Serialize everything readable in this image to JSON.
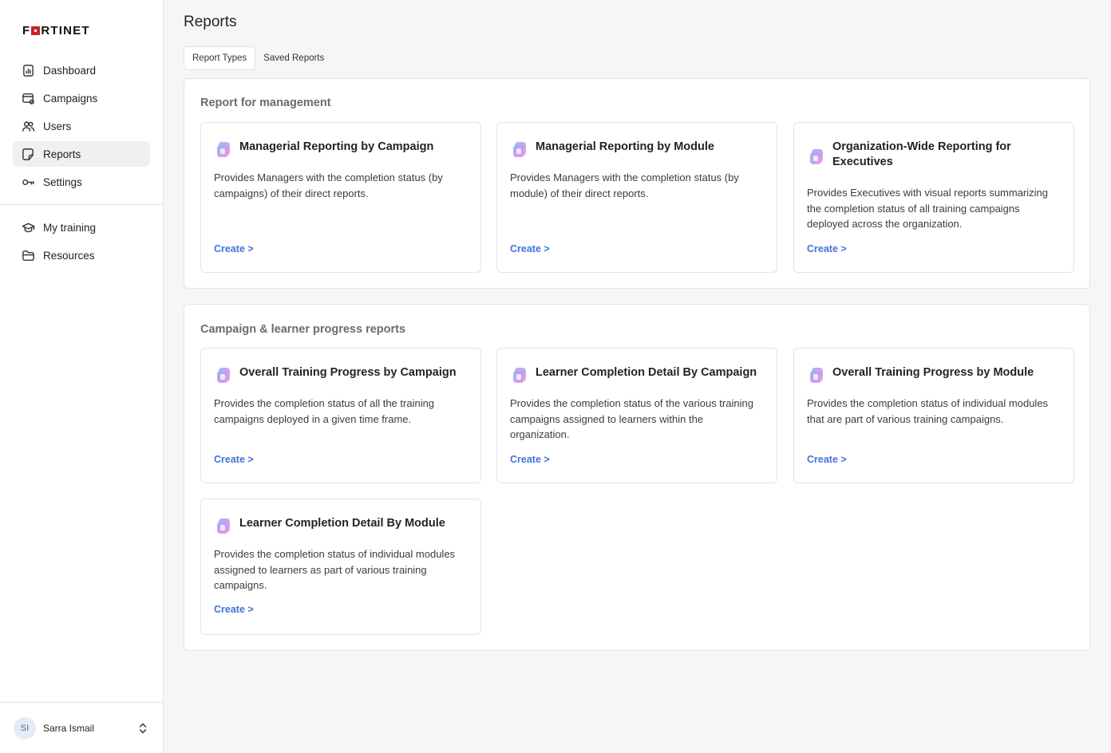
{
  "brand": {
    "logo_text_1": "F",
    "logo_text_2": "RTINET"
  },
  "sidebar": {
    "items": [
      {
        "label": "Dashboard"
      },
      {
        "label": "Campaigns"
      },
      {
        "label": "Users"
      },
      {
        "label": "Reports"
      },
      {
        "label": "Settings"
      }
    ],
    "secondary_items": [
      {
        "label": "My training"
      },
      {
        "label": "Resources"
      }
    ],
    "user": {
      "initials": "SI",
      "name": "Sarra Ismail"
    }
  },
  "page": {
    "title": "Reports",
    "tabs": [
      {
        "label": "Report Types"
      },
      {
        "label": "Saved Reports"
      }
    ]
  },
  "sections": [
    {
      "title": "Report for management",
      "cards": [
        {
          "title": "Managerial Reporting by Campaign",
          "description": "Provides Managers with the completion status (by campaigns) of their direct reports.",
          "action": "Create >"
        },
        {
          "title": "Managerial Reporting by Module",
          "description": "Provides Managers with the completion status (by module) of their direct reports.",
          "action": "Create >"
        },
        {
          "title": "Organization-Wide Reporting for Executives",
          "description": "Provides Executives with visual reports summarizing the completion status of all training campaigns deployed across the organization.",
          "action": "Create >"
        }
      ]
    },
    {
      "title": "Campaign & learner progress reports",
      "cards": [
        {
          "title": "Overall Training Progress by Campaign",
          "description": "Provides the completion status of all the training campaigns deployed in a given time frame.",
          "action": "Create >"
        },
        {
          "title": "Learner Completion Detail By Campaign",
          "description": "Provides the completion status of the various training campaigns assigned to learners within the organization.",
          "action": "Create >"
        },
        {
          "title": "Overall Training Progress by Module",
          "description": "Provides the completion status of individual modules that are part of various training campaigns.",
          "action": "Create >"
        },
        {
          "title": "Learner Completion Detail By Module",
          "description": "Provides the completion status of individual modules assigned to learners as part of various training campaigns.",
          "action": "Create >"
        }
      ]
    }
  ],
  "colors": {
    "accent_link": "#3f74d9",
    "logo_red": "#d01f28",
    "active_nav_bg": "#f0f0f2"
  },
  "icons": {
    "dashboard": "chart-report-icon",
    "campaigns": "campaign-icon",
    "users": "users-icon",
    "reports": "reports-icon",
    "settings": "key-icon",
    "my_training": "graduation-cap-icon",
    "resources": "folder-icon",
    "card": "report-card-icon",
    "user_menu": "chevron-up-down-icon"
  }
}
